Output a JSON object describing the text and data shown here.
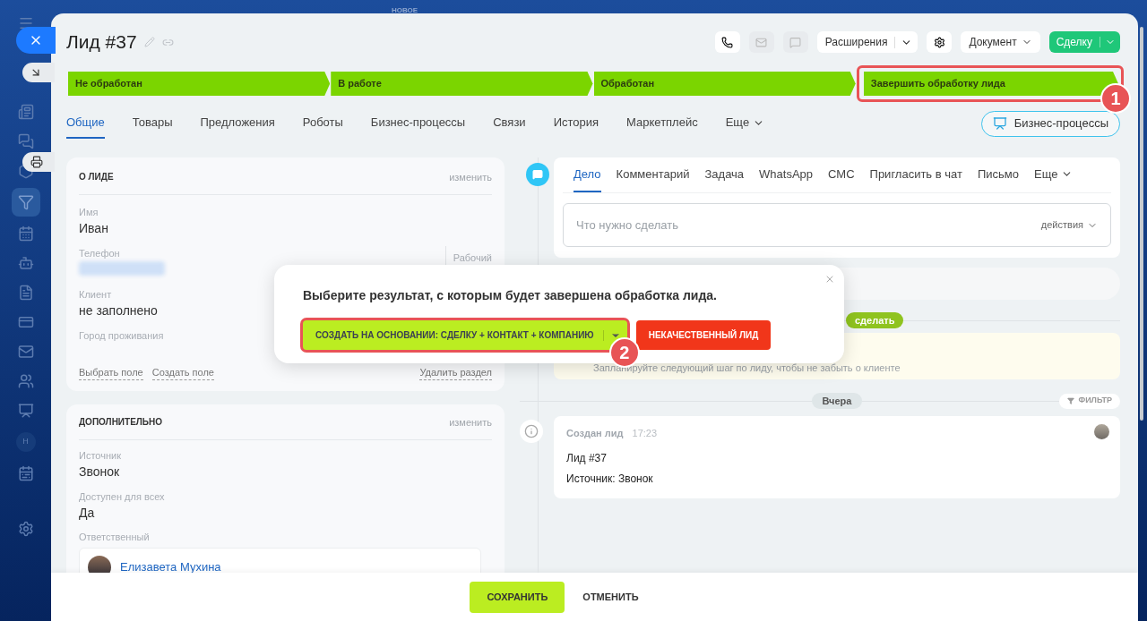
{
  "sidebar": {
    "new_label": "НОВОЕ",
    "avatar": "Н"
  },
  "header": {
    "title": "Лид #37",
    "extensions": "Расширения",
    "document": "Документ",
    "convert": "Сделку"
  },
  "stages": [
    {
      "label": "Не обработан"
    },
    {
      "label": "В работе"
    },
    {
      "label": "Обработан"
    },
    {
      "label": "Завершить обработку лида",
      "callout": "1"
    }
  ],
  "tabs": [
    {
      "label": "Общие",
      "selected": true,
      "dropdown": false
    },
    {
      "label": "Товары",
      "selected": false,
      "dropdown": false
    },
    {
      "label": "Предложения",
      "selected": false,
      "dropdown": false
    },
    {
      "label": "Роботы",
      "selected": false,
      "dropdown": false
    },
    {
      "label": "Бизнес-процессы",
      "selected": false,
      "dropdown": false
    },
    {
      "label": "Связи",
      "selected": false,
      "dropdown": false
    },
    {
      "label": "История",
      "selected": false,
      "dropdown": false
    },
    {
      "label": "Маркетплейс",
      "selected": false,
      "dropdown": false
    },
    {
      "label": "Еще",
      "selected": false,
      "dropdown": true
    }
  ],
  "bp_button": "Бизнес-процессы",
  "about": {
    "title": "О ЛИДЕ",
    "edit": "изменить",
    "fields": [
      {
        "kind": "text",
        "label": "Имя",
        "value": "Иван"
      },
      {
        "kind": "phone",
        "label": "Телефон",
        "extra": "Рабочий"
      },
      {
        "kind": "text",
        "label": "Клиент",
        "value": "не заполнено"
      },
      {
        "kind": "empty",
        "label": "Город проживания"
      }
    ],
    "links": [
      "Выбрать поле",
      "Создать поле"
    ],
    "delete": "Удалить раздел"
  },
  "extra": {
    "title": "ДОПОЛНИТЕЛЬНО",
    "edit": "изменить",
    "fields": [
      {
        "kind": "text",
        "label": "Источник",
        "value": "Звонок"
      },
      {
        "kind": "text",
        "label": "Доступен для всех",
        "value": "Да"
      }
    ],
    "responsible_label": "Ответственный",
    "responsible_name": "Елизавета Мухина"
  },
  "activity": {
    "tabs": [
      {
        "label": "Дело",
        "selected": true,
        "dropdown": false
      },
      {
        "label": "Комментарий",
        "selected": false,
        "dropdown": false
      },
      {
        "label": "Задача",
        "selected": false,
        "dropdown": false
      },
      {
        "label": "WhatsApp",
        "selected": false,
        "dropdown": false
      },
      {
        "label": "СМС",
        "selected": false,
        "dropdown": false
      },
      {
        "label": "Пригласить в чат",
        "selected": false,
        "dropdown": false
      },
      {
        "label": "Письмо",
        "selected": false,
        "dropdown": false
      },
      {
        "label": "Еще",
        "selected": false,
        "dropdown": true
      }
    ],
    "placeholder": "Что нужно сделать",
    "actions": "действия"
  },
  "timeline": {
    "badge": "сделать",
    "hint": "Запланируйте следующий шаг по лиду, чтобы не забыть о клиенте",
    "divider": "Вчера",
    "filter": "ФИЛЬТР",
    "entry_title": "Создан лид",
    "entry_time": "17:23",
    "entry_lines": [
      "Лид #37",
      "Источник: Звонок"
    ]
  },
  "popup": {
    "message": "Выберите результат, с которым будет завершена обработка лида.",
    "primary": "СОЗДАТЬ НА ОСНОВАНИИ: СДЕЛКУ + КОНТАКТ + КОМПАНИЮ",
    "primary_callout": "2",
    "secondary": "НЕКАЧЕСТВЕННЫЙ ЛИД"
  },
  "footer": {
    "save": "СОХРАНИТЬ",
    "cancel": "ОТМЕНИТЬ"
  }
}
